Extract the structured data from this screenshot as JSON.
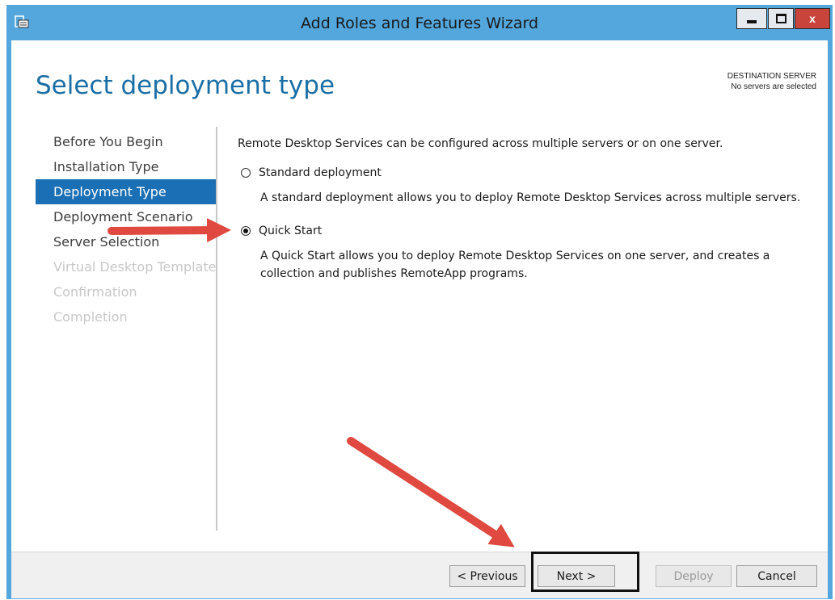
{
  "window": {
    "title": "Add Roles and Features Wizard",
    "controls": {
      "minimize": "_",
      "maximize": "□",
      "close": "x"
    }
  },
  "header": {
    "page_title": "Select deployment type",
    "destination_label": "DESTINATION SERVER",
    "destination_value": "No servers are selected"
  },
  "nav": {
    "items": [
      {
        "label": "Before You Begin",
        "state": "normal"
      },
      {
        "label": "Installation Type",
        "state": "normal"
      },
      {
        "label": "Deployment Type",
        "state": "active"
      },
      {
        "label": "Deployment Scenario",
        "state": "normal"
      },
      {
        "label": "Server Selection",
        "state": "normal"
      },
      {
        "label": "Virtual Desktop Template",
        "state": "disabled"
      },
      {
        "label": "Confirmation",
        "state": "disabled"
      },
      {
        "label": "Completion",
        "state": "disabled"
      }
    ]
  },
  "content": {
    "intro": "Remote Desktop Services can be configured across multiple servers or on one server.",
    "options": [
      {
        "label": "Standard deployment",
        "selected": false,
        "description": "A standard deployment allows you to deploy Remote Desktop Services across multiple servers."
      },
      {
        "label": "Quick Start",
        "selected": true,
        "description": "A Quick Start allows you to deploy Remote Desktop Services on one server, and creates a collection and publishes RemoteApp programs."
      }
    ]
  },
  "footer": {
    "previous": "< Previous",
    "next": "Next >",
    "deploy": "Deploy",
    "cancel": "Cancel"
  },
  "colors": {
    "accent": "#1b6fb4",
    "title": "#1a6ea6",
    "frame": "#53a7dd",
    "annotation_arrow": "#e0493f",
    "close_button": "#c9453c"
  }
}
